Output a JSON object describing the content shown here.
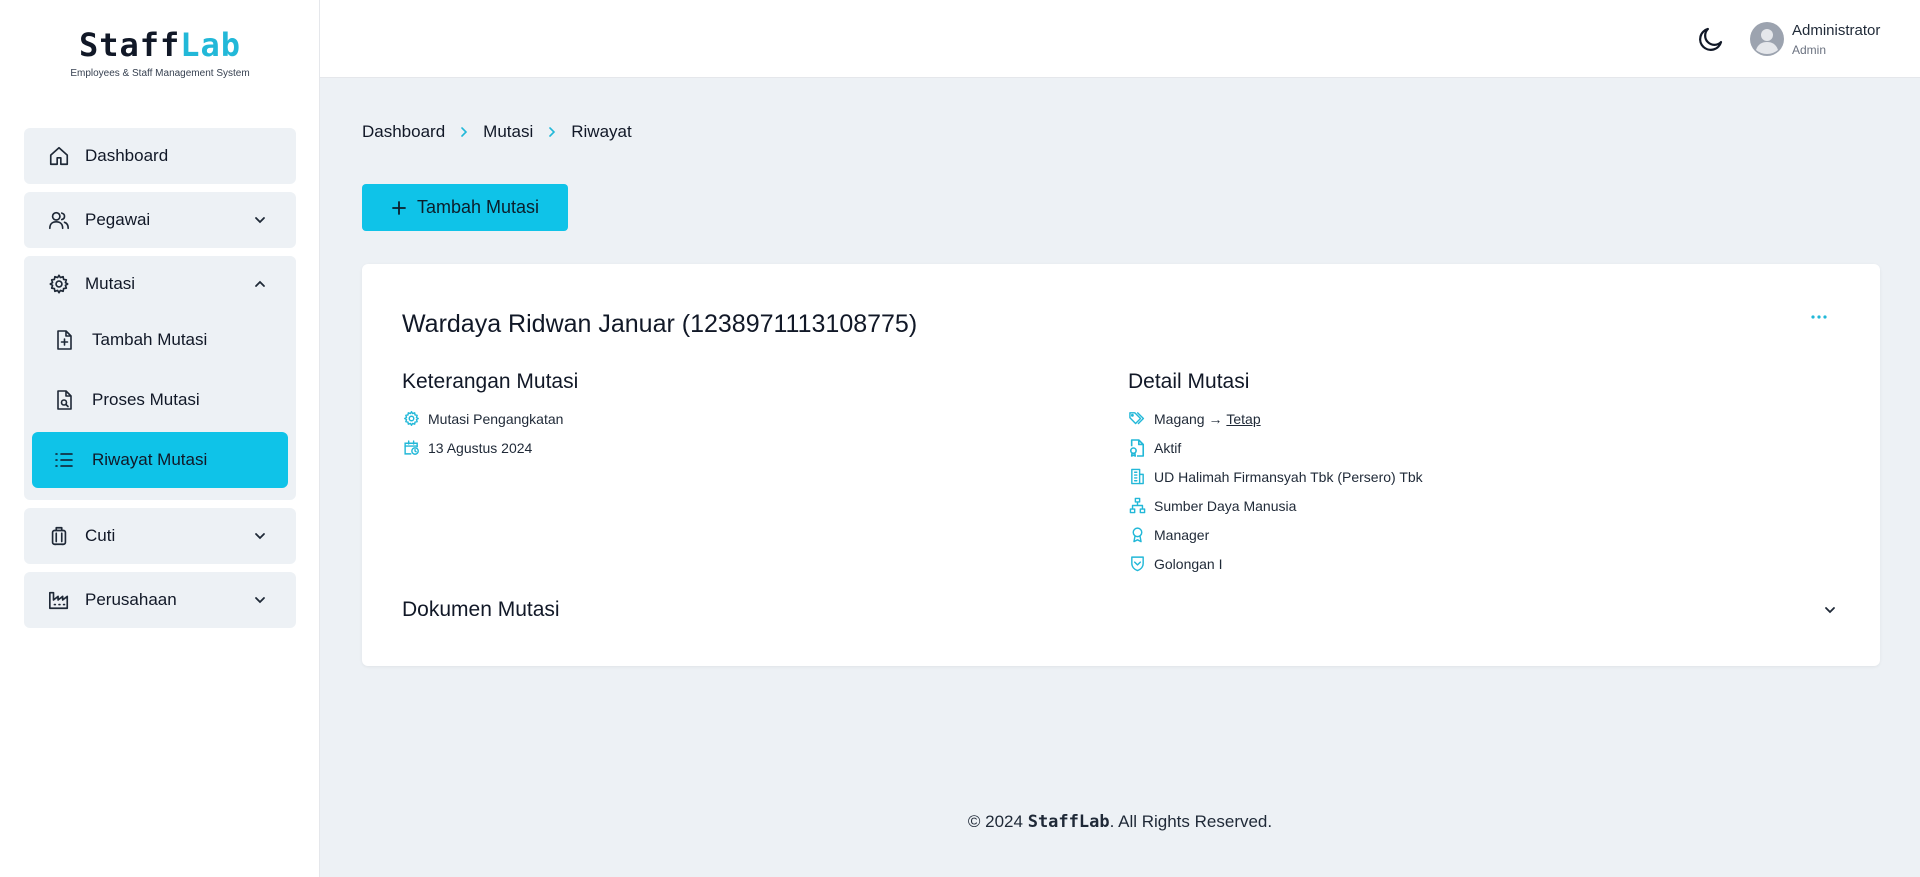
{
  "brand": {
    "name_part1": "Staff",
    "name_part2": "Lab",
    "tagline": "Employees & Staff Management System",
    "accent_color": "#22b8d8"
  },
  "sidebar": {
    "items": [
      {
        "label": "Dashboard",
        "icon": "home-icon"
      },
      {
        "label": "Pegawai",
        "icon": "users-icon",
        "expanded": false
      },
      {
        "label": "Mutasi",
        "icon": "gear-icon",
        "expanded": true,
        "children": [
          {
            "label": "Tambah Mutasi",
            "icon": "file-plus-icon"
          },
          {
            "label": "Proses Mutasi",
            "icon": "file-search-icon"
          },
          {
            "label": "Riwayat Mutasi",
            "icon": "list-icon",
            "active": true
          }
        ]
      },
      {
        "label": "Cuti",
        "icon": "luggage-icon",
        "expanded": false
      },
      {
        "label": "Perusahaan",
        "icon": "factory-icon",
        "expanded": false
      }
    ],
    "active_color": "#0fc3e8"
  },
  "header": {
    "user_name": "Administrator",
    "user_role": "Admin"
  },
  "breadcrumb": [
    "Dashboard",
    "Mutasi",
    "Riwayat"
  ],
  "actions": {
    "add_label": "Tambah Mutasi"
  },
  "card": {
    "title": "Wardaya Ridwan Januar (1238971113108775)",
    "keterangan": {
      "heading": "Keterangan Mutasi",
      "type": "Mutasi Pengangkatan",
      "date": "13 Agustus 2024"
    },
    "detail": {
      "heading": "Detail Mutasi",
      "status_from": "Magang",
      "arrow": "→",
      "status_to": "Tetap",
      "active": "Aktif",
      "company": "UD Halimah Firmansyah Tbk (Persero) Tbk",
      "department": "Sumber Daya Manusia",
      "position": "Manager",
      "grade": "Golongan I"
    },
    "documents_heading": "Dokumen Mutasi"
  },
  "footer": {
    "prefix": "© 2024",
    "brand": "StaffLab",
    "suffix": ". All Rights Reserved."
  }
}
